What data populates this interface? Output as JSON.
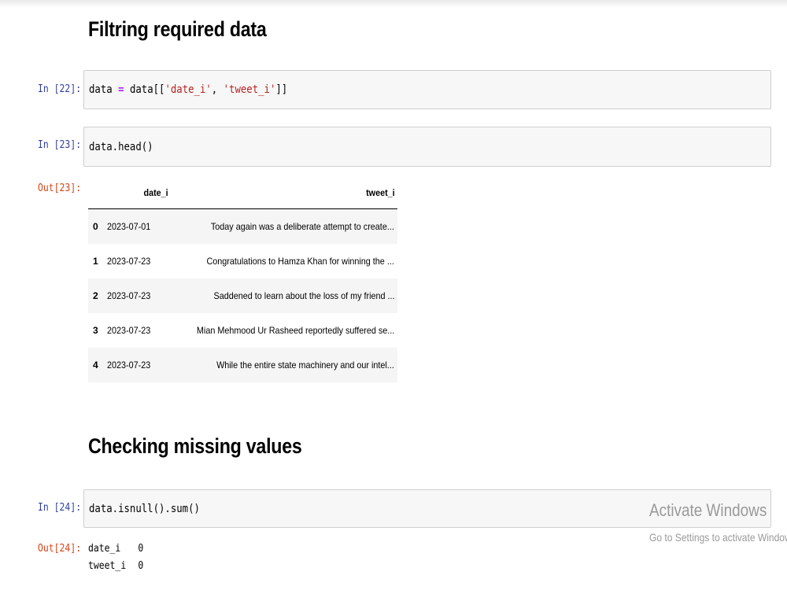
{
  "sections": {
    "filtering_heading": "Filtring required data",
    "missing_heading": "Checking missing values"
  },
  "cells": [
    {
      "prompt": "In [22]:",
      "code_parts": [
        "data ",
        "=",
        " data[[",
        "'date_i'",
        ", ",
        "'tweet_i'",
        "]]"
      ]
    },
    {
      "prompt": "In [23]:",
      "code": "data.head()"
    },
    {
      "prompt": "In [24]:",
      "code": "data.isnull().sum()"
    }
  ],
  "outputs": {
    "out23_prompt": "Out[23]:",
    "out24_prompt": "Out[24]:"
  },
  "dataframe": {
    "columns": [
      "date_i",
      "tweet_i"
    ],
    "rows": [
      {
        "index": "0",
        "date_i": "2023-07-01",
        "tweet_i": "Today again was a deliberate attempt to create..."
      },
      {
        "index": "1",
        "date_i": "2023-07-23",
        "tweet_i": "Congratulations to Hamza Khan for winning the ..."
      },
      {
        "index": "2",
        "date_i": "2023-07-23",
        "tweet_i": "Saddened to learn about the loss of my friend ..."
      },
      {
        "index": "3",
        "date_i": "2023-07-23",
        "tweet_i": "Mian Mehmood Ur Rasheed reportedly suffered se..."
      },
      {
        "index": "4",
        "date_i": "2023-07-23",
        "tweet_i": "While the entire state machinery and our intel..."
      }
    ]
  },
  "series_output": [
    {
      "name": "date_i",
      "value": "0"
    },
    {
      "name": "tweet_i",
      "value": "0"
    }
  ],
  "watermark": {
    "title": "Activate Windows",
    "subtitle": "Go to Settings to activate Windows."
  }
}
